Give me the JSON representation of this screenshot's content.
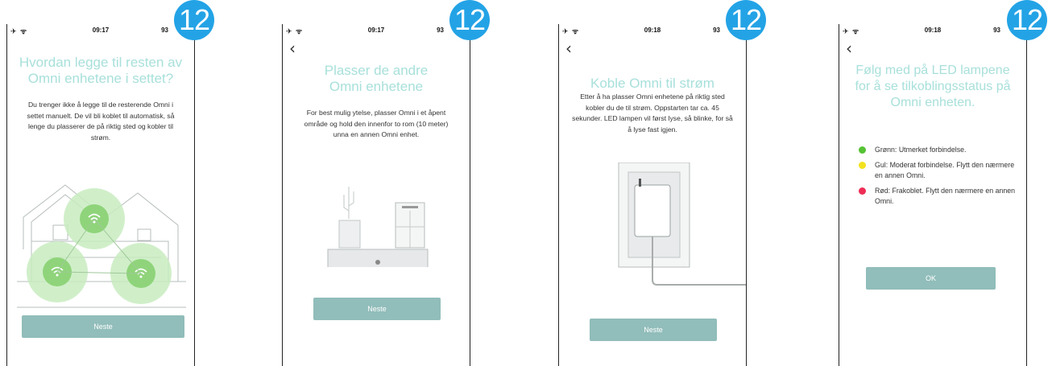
{
  "badge": "12",
  "colors": {
    "accent": "#a8e0db",
    "button": "#91bdba",
    "badge": "#23a3e6",
    "green": "#55c233",
    "yellow": "#f2e21f",
    "red": "#ee2d55"
  },
  "screens": [
    {
      "status": {
        "left": "✈ ᯤ",
        "time": "09:17",
        "battery": "93"
      },
      "title": "Hvordan legge til resten av Omni enhetene i settet?",
      "body": "Du trenger ikke å legge til de resterende Omni i settet manuelt. De vil bli koblet til automatisk, så lenge du plasserer de på riktig sted og kobler til strøm.",
      "button": "Neste"
    },
    {
      "status": {
        "left": "✈ ᯤ",
        "time": "09:17",
        "battery": "93"
      },
      "back": "‹",
      "title": "Plasser de andre Omni enhetene",
      "body": "For best mulig ytelse, plasser Omni i et åpent område og hold den innenfor to rom (10 meter) unna en annen Omni enhet.",
      "button": "Neste"
    },
    {
      "status": {
        "left": "✈ ᯤ",
        "time": "09:18",
        "battery": "93"
      },
      "back": "‹",
      "title": "Koble Omni til strøm",
      "body": "Etter å ha plasser Omni enhetene på riktig sted kobler du de til strøm. Oppstarten tar ca. 45 sekunder. LED lampen vil først lyse, så blinke, for så å lyse fast igjen.",
      "button": "Neste"
    },
    {
      "status": {
        "left": "✈ ᯤ",
        "time": "09:18",
        "battery": "93"
      },
      "back": "‹",
      "title": "Følg med på LED lampene for å se tilkoblingsstatus på Omni enheten.",
      "led": [
        {
          "color": "#55c233",
          "text": "Grønn: Utmerket forbindelse."
        },
        {
          "color": "#f2e21f",
          "text": "Gul: Moderat forbindelse. Flytt den nærmere en annen Omni."
        },
        {
          "color": "#ee2d55",
          "text": "Rød: Frakoblet. Flytt den nærmere en annen Omni."
        }
      ],
      "button": "OK"
    }
  ]
}
